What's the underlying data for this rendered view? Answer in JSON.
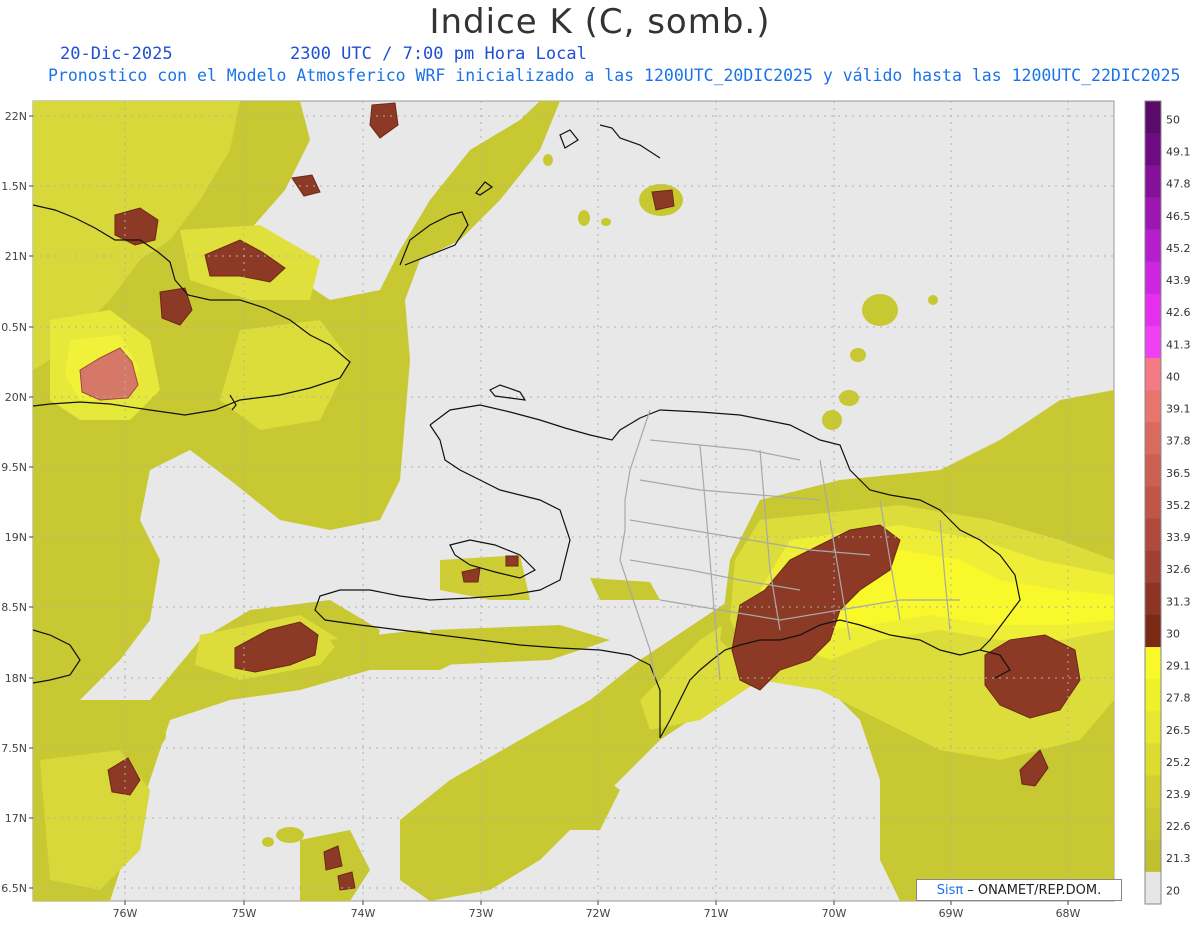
{
  "header": {
    "title": "Indice K (C, somb.)",
    "date": "20-Dic-2025",
    "time": "2300 UTC / 7:00 pm Hora Local",
    "description": "Pronostico con el Modelo Atmosferico WRF inicializado a las 1200UTC_20DIC2025 y válido hasta las  1200UTC_22DIC2025"
  },
  "map": {
    "lat_labels": [
      "22N",
      "1.5N",
      "21N",
      "0.5N",
      "20N",
      "9.5N",
      "19N",
      "8.5N",
      "18N",
      "7.5N",
      "17N",
      "6.5N"
    ],
    "lon_labels": [
      "76W",
      "75W",
      "74W",
      "73W",
      "72W",
      "71W",
      "70W",
      "69W",
      "68W"
    ],
    "background_color": "#e8e8e8"
  },
  "legend": {
    "values": [
      "50",
      "49.1",
      "47.8",
      "46.5",
      "45.2",
      "43.9",
      "42.6",
      "41.3",
      "40",
      "39.1",
      "37.8",
      "36.5",
      "35.2",
      "33.9",
      "32.6",
      "31.3",
      "30",
      "29.1",
      "27.8",
      "26.5",
      "25.2",
      "23.9",
      "22.6",
      "21.3",
      "20"
    ],
    "colors": [
      "#5a0a6a",
      "#6e0a82",
      "#85109a",
      "#9c16b2",
      "#b41ecb",
      "#cc26e0",
      "#e430ee",
      "#f040f4",
      "#f47a86",
      "#e8766e",
      "#d86a5e",
      "#cc6052",
      "#c05548",
      "#b04a3e",
      "#a04034",
      "#8e3424",
      "#7a2a14",
      "#f8f82a",
      "#eef02a",
      "#e6e82e",
      "#dcdc30",
      "#d2d030",
      "#c8c830",
      "#c0c030",
      "#e6e6e6"
    ]
  },
  "credit": {
    "brand": "Sisπ",
    "text": "– ONAMET/REP.DOM."
  }
}
